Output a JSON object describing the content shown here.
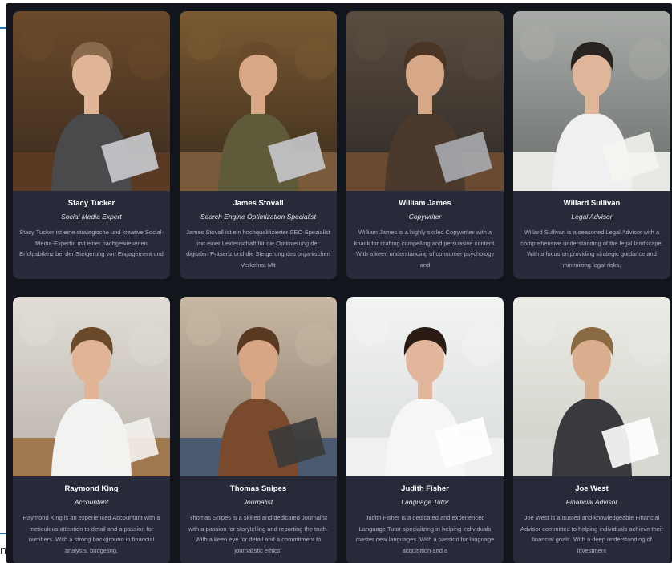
{
  "team": [
    {
      "name": "Stacy Tucker",
      "role": "Social Media Expert",
      "bio": "Stacy Tucker ist eine strategische und kreative Social-Media-Expertin mit einer nachgewiesenen Erfolgsbilanz bei der Steigerung von Engagement und",
      "palette": {
        "bg": "#3a2a1f",
        "bg2": "#6b4a2a",
        "hair": "#8a6a4a",
        "skin": "#e0b496",
        "shirt": "#4a4a4c",
        "laptop": "#c9cbd0",
        "table": "#5a3a22"
      }
    },
    {
      "name": "James Stovall",
      "role": "Search Engine Optimization Specialist",
      "bio": "James Stovall ist ein hochqualifizierter SEO-Spezialist mit einer Leidenschaft für die Optimierung der digitalen Präsenz und die Steigerung des organischen Verkehrs. Mit",
      "palette": {
        "bg": "#3b2b1c",
        "bg2": "#7a5a32",
        "hair": "#6a4a2a",
        "skin": "#d8a886",
        "shirt": "#5f5a3a",
        "laptop": "#c8c8cc",
        "table": "#7a5a3a"
      }
    },
    {
      "name": "William James",
      "role": "Copywriter",
      "bio": "William James is a highly skilled Copywriter with a knack for crafting compelling and persuasive content. With a keen understanding of consumer psychology and",
      "palette": {
        "bg": "#2f2a26",
        "bg2": "#5a4c40",
        "hair": "#4a3424",
        "skin": "#d6a888",
        "shirt": "#4b3a2c",
        "laptop": "#a9abb0",
        "table": "#6a4a30"
      }
    },
    {
      "name": "Willard Sullivan",
      "role": "Legal Advisor",
      "bio": "Willard Sullivan is a seasoned Legal Advisor with a comprehensive understanding of the legal landscape. With a focus on providing strategic guidance and minimizing legal risks,",
      "palette": {
        "bg": "#6a6e6a",
        "bg2": "#a9aca8",
        "hair": "#2a2420",
        "skin": "#e0b69a",
        "shirt": "#f0f0f2",
        "laptop": "#f4f4f0",
        "table": "#e8e8e4"
      }
    },
    {
      "name": "Raymond King",
      "role": "Accountant",
      "bio": "Raymond King is an experienced Accountant with a meticulous attention to detail and a passion for numbers. With a strong background in financial analysis, budgeting,",
      "palette": {
        "bg": "#b8b2aa",
        "bg2": "#e2ddd6",
        "hair": "#6a4a2a",
        "skin": "#e2b496",
        "shirt": "#f2f2f0",
        "laptop": "#f4f2ee",
        "table": "#a07850"
      }
    },
    {
      "name": "Thomas Snipes",
      "role": "Journalist",
      "bio": "Thomas Snipes is a skilled and dedicated Journalist with a passion for storytelling and reporting the truth. With a keen eye for detail and a commitment to journalistic ethics,",
      "palette": {
        "bg": "#8a7a6a",
        "bg2": "#c8b8a4",
        "hair": "#5a3a22",
        "skin": "#d8a684",
        "shirt": "#7a4a2e",
        "laptop": "#3a3a3a",
        "table": "#4a5a70"
      }
    },
    {
      "name": "Judith Fisher",
      "role": "Language Tutor",
      "bio": "Judith Fisher is a dedicated and experienced Language Tutor specializing in helping individuals master new languages. With a passion for language acquisition and a",
      "palette": {
        "bg": "#d8dcdc",
        "bg2": "#f2f4f2",
        "hair": "#2a1c14",
        "skin": "#e2b69c",
        "shirt": "#f6f6f6",
        "laptop": "#ffffff",
        "table": "#f0f0ee"
      }
    },
    {
      "name": "Joe West",
      "role": "Financial Advisor",
      "bio": "Joe West is a trusted and knowledgeable Financial Advisor committed to helping individuals achieve their financial goals. With a deep understanding of investment",
      "palette": {
        "bg": "#cfcfc8",
        "bg2": "#ecece6",
        "hair": "#8a6a42",
        "skin": "#dcae90",
        "shirt": "#3a3a3e",
        "laptop": "#ffffff",
        "table": "#d8d8d2"
      }
    }
  ]
}
